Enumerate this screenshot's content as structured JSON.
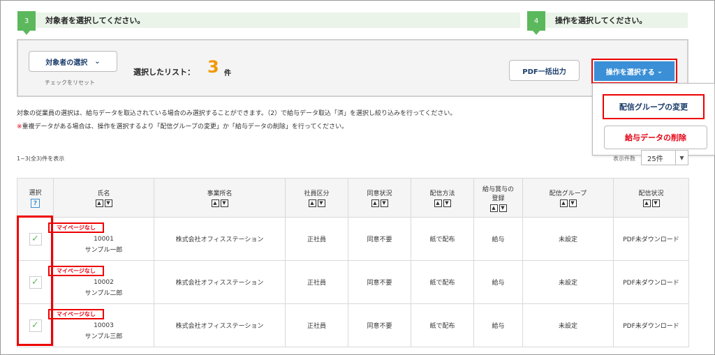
{
  "steps": {
    "step3": {
      "num": "3",
      "text": "対象者を選択してください。"
    },
    "step4": {
      "num": "4",
      "text": "操作を選択してください。"
    }
  },
  "panel": {
    "select_button": "対象者の選択",
    "reset_link": "チェックをリセット",
    "list_label": "選択したリスト：",
    "list_count": "3",
    "list_unit": "件",
    "pdf_button": "PDF一括出力",
    "operation_button": "操作を選択する"
  },
  "dropdown": {
    "change_group": "配信グループの変更",
    "delete_salary": "給与データの削除"
  },
  "notes": {
    "line1": "対象の従業員の選択は、給与データを取込されている場合のみ選択することができます。（2）で給与データ取込「済」を選択し絞り込みを行ってください。",
    "line2_mark": "※",
    "line2": "重複データがある場合は、操作を選択するより「配信グループの変更」か「給与データの削除」を行ってください。"
  },
  "list_info": {
    "range": "1~3(全3)件を表示",
    "per_page_label": "表示件数",
    "per_page_value": "25件"
  },
  "table": {
    "headers": {
      "select": "選択",
      "name": "氏名",
      "office": "事業所名",
      "emp_type": "社員区分",
      "consent": "同意状況",
      "delivery": "配信方法",
      "salary_reg_1": "給与賞与の",
      "salary_reg_2": "登録",
      "group": "配信グループ",
      "status": "配信状況"
    },
    "help_icon": "?",
    "rows": [
      {
        "badge": "マイページなし",
        "id": "10001",
        "name": "サンプル一郎",
        "office": "株式会社オフィスステーション",
        "emp_type": "正社員",
        "consent": "同意不要",
        "delivery": "紙で配布",
        "salary": "給与",
        "group": "未設定",
        "status": "PDF未ダウンロード"
      },
      {
        "badge": "マイページなし",
        "id": "10002",
        "name": "サンプル二郎",
        "office": "株式会社オフィスステーション",
        "emp_type": "正社員",
        "consent": "同意不要",
        "delivery": "紙で配布",
        "salary": "給与",
        "group": "未設定",
        "status": "PDF未ダウンロード"
      },
      {
        "badge": "マイページなし",
        "id": "10003",
        "name": "サンプル三郎",
        "office": "株式会社オフィスステーション",
        "emp_type": "正社員",
        "consent": "同意不要",
        "delivery": "紙で配布",
        "salary": "給与",
        "group": "未設定",
        "status": "PDF未ダウンロード"
      }
    ]
  },
  "colors": {
    "accent_green": "#5cb85c",
    "button_blue": "#3a8fd6",
    "highlight_red": "#e00000",
    "count_orange": "#f39800"
  }
}
